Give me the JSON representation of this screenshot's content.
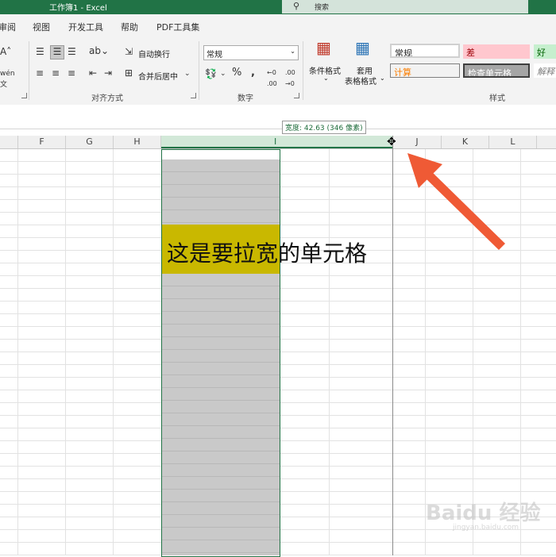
{
  "app": {
    "title": "工作簿1 - Excel",
    "search": "搜索"
  },
  "tabs": [
    {
      "label": "审阅"
    },
    {
      "label": "视图"
    },
    {
      "label": "开发工具"
    },
    {
      "label": "帮助"
    },
    {
      "label": "PDF工具集"
    }
  ],
  "ribbon": {
    "alignment": {
      "group_label": "对齐方式",
      "wrap_text": "自动换行",
      "merge_center": "合并后居中"
    },
    "number": {
      "group_label": "数字",
      "format_value": "常规"
    },
    "styles": {
      "group_label": "样式",
      "conditional_format": [
        "条件格式",
        ""
      ],
      "table_format": [
        "套用",
        "表格格式"
      ],
      "cell_styles": [
        {
          "label": "常规",
          "fg": "#222222",
          "bg": "#ffffff"
        },
        {
          "label": "差",
          "fg": "#9c0006",
          "bg": "#ffc7ce"
        },
        {
          "label": "好",
          "fg": "#006100",
          "bg": "#c6efce"
        },
        {
          "label": "计算",
          "fg": "#fa7d00",
          "bg": "#f2f2f2"
        },
        {
          "label": "检查单元格",
          "fg": "#ffffff",
          "bg": "#a5a5a5"
        },
        {
          "label": "解释",
          "fg": "#7f7f7f",
          "bg": "#ffffff"
        }
      ]
    }
  },
  "tooltip": "宽度: 42.63 (346 像素)",
  "columns": [
    "F",
    "G",
    "H",
    "I",
    "J",
    "K",
    "L"
  ],
  "cell": {
    "text": "这是要拉宽的单元格"
  },
  "watermark": {
    "text": "Baidu 经验",
    "sub": "jingyan.baidu.com"
  },
  "colors": {
    "accent": "#217346",
    "highlight": "#c9b800",
    "arrow": "#ef5a35"
  }
}
